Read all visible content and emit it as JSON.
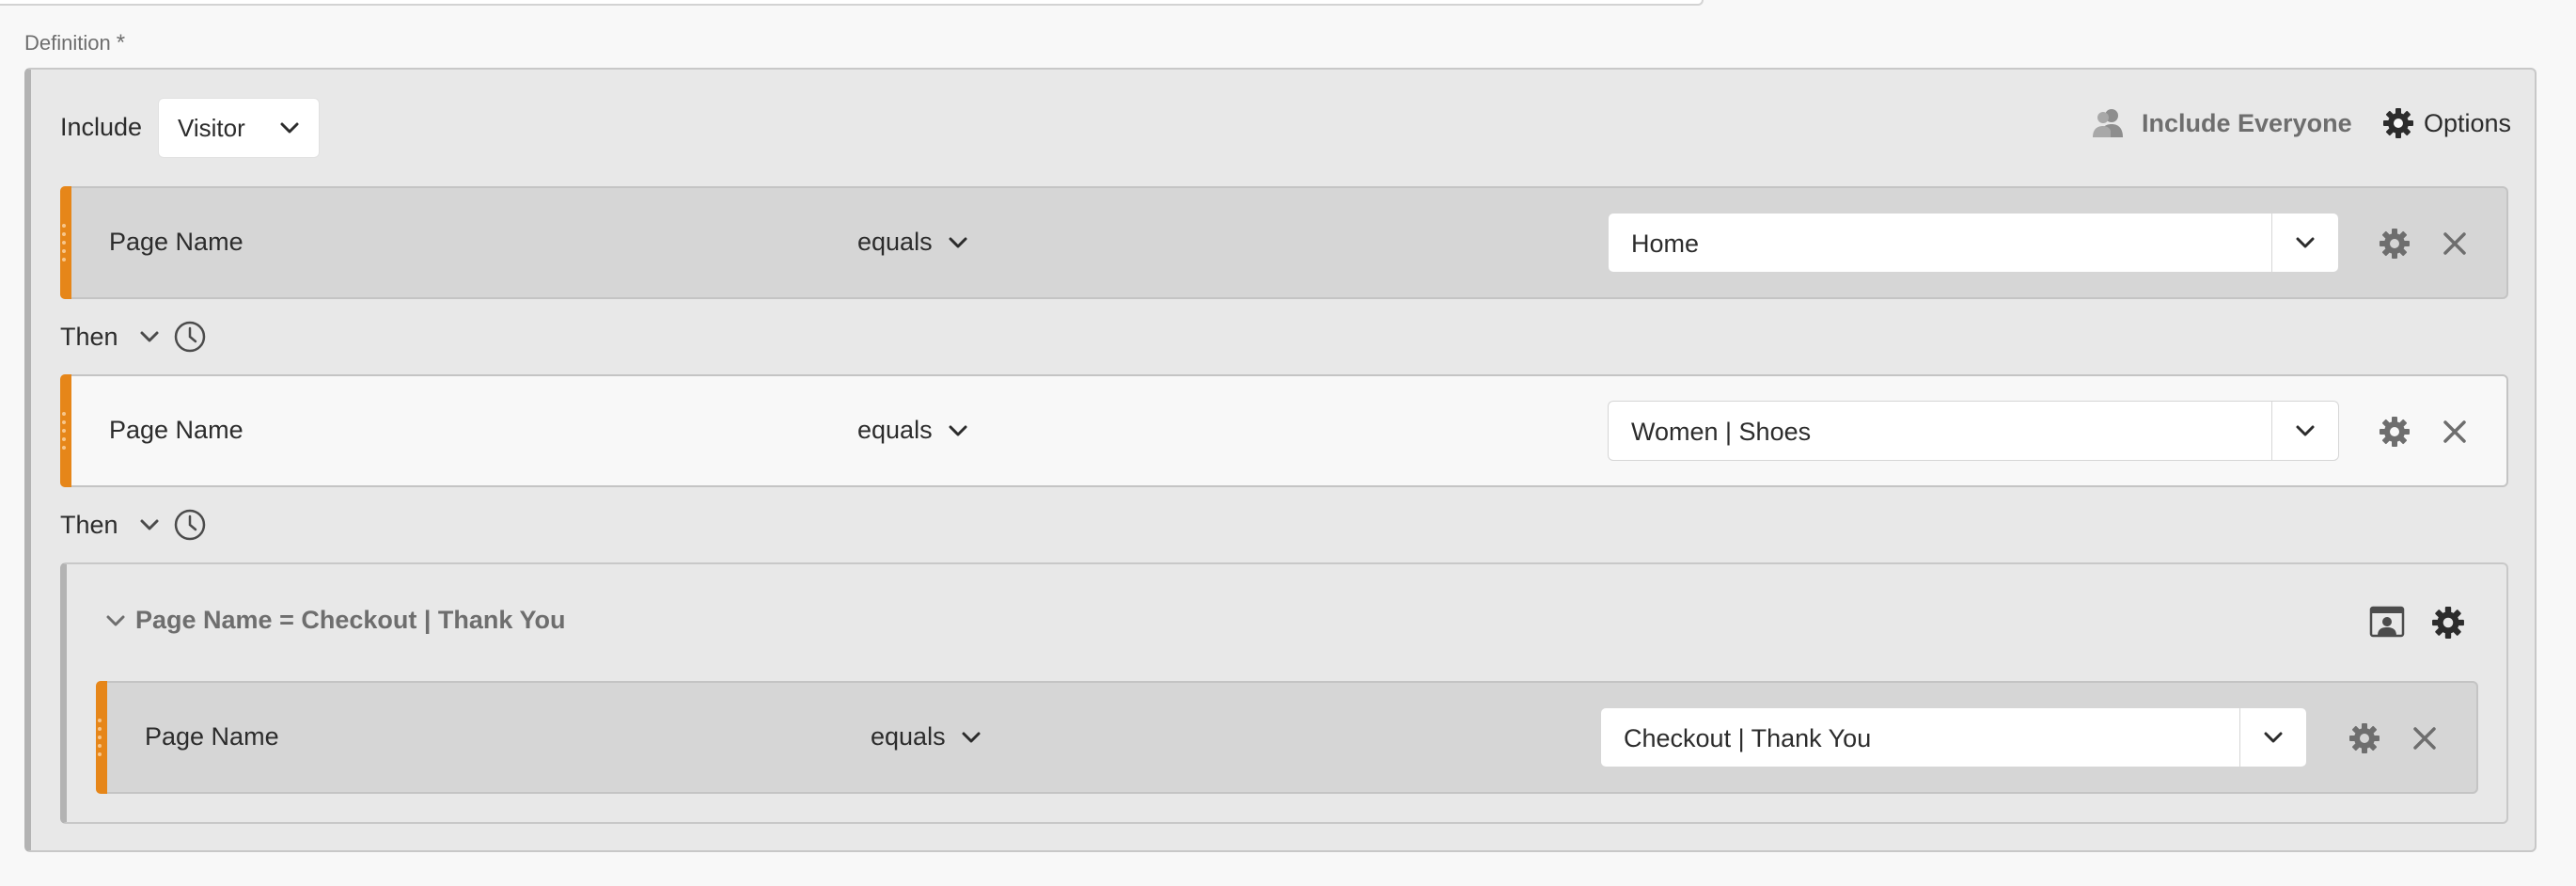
{
  "definition": {
    "label": "Definition",
    "required_mark": "*"
  },
  "container": {
    "include_label": "Include",
    "context_value": "Visitor",
    "include_everyone_label": "Include Everyone",
    "options_label": "Options"
  },
  "rules": [
    {
      "dimension": "Page Name",
      "operator": "equals",
      "value": "Home"
    },
    {
      "dimension": "Page Name",
      "operator": "equals",
      "value": "Women | Shoes"
    }
  ],
  "then_labels": [
    "Then",
    "Then"
  ],
  "group": {
    "title": "Page Name = Checkout | Thank You",
    "rule": {
      "dimension": "Page Name",
      "operator": "equals",
      "value": "Checkout | Thank You"
    }
  },
  "icons": {
    "accent_color": "#e68619",
    "include_everyone": "users-icon",
    "options": "gear-icon",
    "rule_settings": "gear-icon",
    "rule_remove": "close-icon",
    "then_time": "clock-icon",
    "group_collapse": "chevron-down-icon",
    "group_exclude": "person-frame-icon",
    "group_settings": "gear-icon"
  }
}
